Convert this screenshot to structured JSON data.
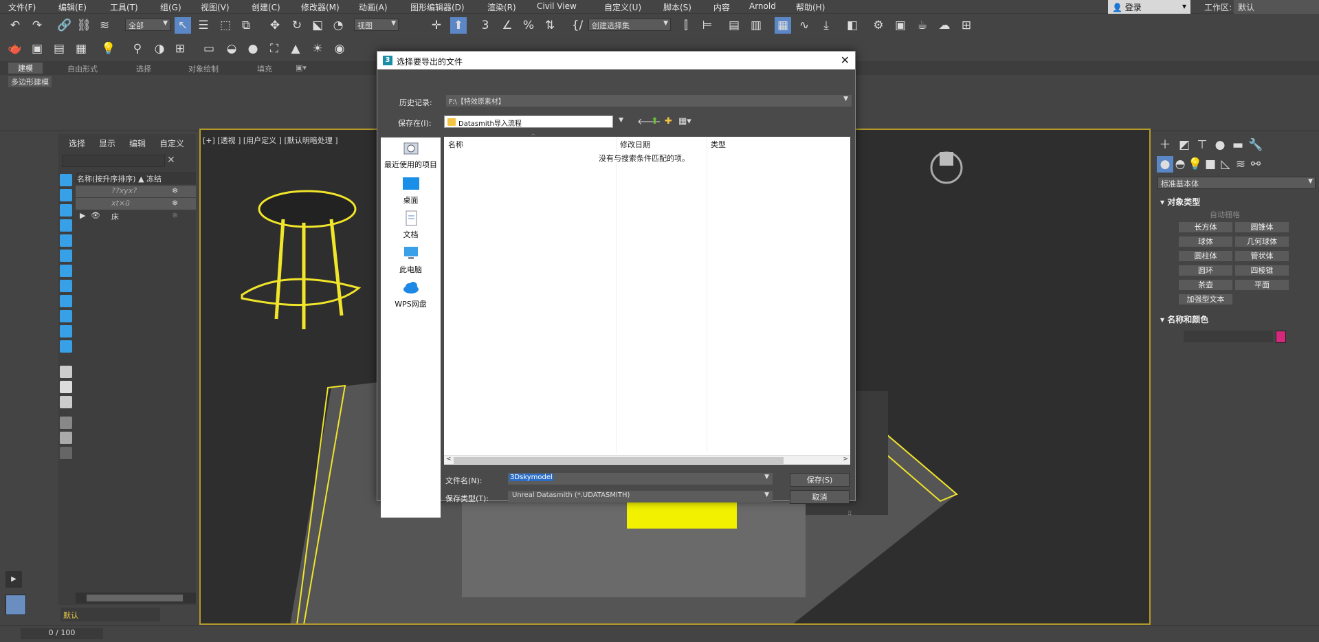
{
  "menu": [
    "文件(F)",
    "编辑(E)",
    "工具(T)",
    "组(G)",
    "视图(V)",
    "创建(C)",
    "修改器(M)",
    "动画(A)",
    "图形编辑器(D)",
    "渲染(R)",
    "Civil View",
    "自定义(U)",
    "脚本(S)",
    "内容",
    "Arnold",
    "帮助(H)"
  ],
  "login": "登录",
  "workspace_label": "工作区:",
  "workspace_value": "默认",
  "toolbar": {
    "filter": "全部",
    "view": "视图",
    "selset": "创建选择集"
  },
  "ribbon_tabs": [
    "建模",
    "自由形式",
    "选择",
    "对象绘制",
    "填充"
  ],
  "ribbon_sub": "多边形建模",
  "scene_tabs": [
    "选择",
    "显示",
    "编辑",
    "自定义"
  ],
  "scene_header": "名称(按升序排序) ▲ 冻结",
  "scene_rows": [
    "??xyx?",
    "xt×ü",
    "床"
  ],
  "viewport_label": "[+] [透视 ] [用户定义 ] [默认明暗处理 ]",
  "cmd": {
    "dropdown": "标准基本体",
    "obj_type": "对象类型",
    "autogrid": "自动栅格",
    "buttons": [
      "长方体",
      "圆锥体",
      "球体",
      "几何球体",
      "圆柱体",
      "管状体",
      "圆环",
      "四棱锥",
      "茶壶",
      "平面",
      "加强型文本"
    ],
    "name_color": "名称和颜色"
  },
  "layer": "默认",
  "frame": "0 / 100",
  "dialog": {
    "title": "选择要导出的文件",
    "history_label": "历史记录:",
    "history_value": "F:\\【特效原素材】",
    "savein_label": "保存在(I):",
    "savein_value": "Datasmith导入流程",
    "places": [
      "最近使用的项目",
      "桌面",
      "文档",
      "此电脑",
      "WPS网盘"
    ],
    "columns": [
      "名称",
      "修改日期",
      "类型"
    ],
    "empty_msg": "没有与搜索条件匹配的项。",
    "filename_label": "文件名(N):",
    "filename_value": "3Dskymodel",
    "filetype_label": "保存类型(T):",
    "filetype_value": "Unreal Datasmith (*.UDATASMITH)",
    "save": "保存(S)",
    "cancel": "取消"
  }
}
